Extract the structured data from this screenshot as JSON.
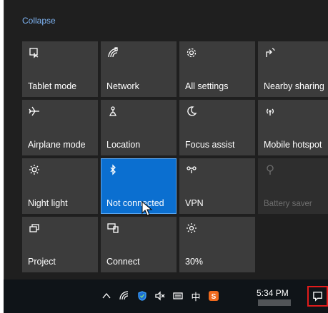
{
  "panel": {
    "collapse_label": "Collapse"
  },
  "tiles": [
    {
      "label": "Tablet mode",
      "icon": "tablet-mode-icon",
      "state": "off"
    },
    {
      "label": "Network",
      "icon": "network-icon",
      "state": "off"
    },
    {
      "label": "All settings",
      "icon": "gear-icon",
      "state": "off"
    },
    {
      "label": "Nearby sharing",
      "icon": "nearby-sharing-icon",
      "state": "off"
    },
    {
      "label": "Airplane mode",
      "icon": "airplane-icon",
      "state": "off"
    },
    {
      "label": "Location",
      "icon": "location-icon",
      "state": "off"
    },
    {
      "label": "Focus assist",
      "icon": "moon-icon",
      "state": "off"
    },
    {
      "label": "Mobile hotspot",
      "icon": "hotspot-icon",
      "state": "off"
    },
    {
      "label": "Night light",
      "icon": "night-light-icon",
      "state": "off"
    },
    {
      "label": "Not connected",
      "icon": "bluetooth-icon",
      "state": "on"
    },
    {
      "label": "VPN",
      "icon": "vpn-icon",
      "state": "off"
    },
    {
      "label": "Battery saver",
      "icon": "battery-saver-icon",
      "state": "disabled"
    },
    {
      "label": "Project",
      "icon": "project-icon",
      "state": "off"
    },
    {
      "label": "Connect",
      "icon": "connect-icon",
      "state": "off"
    },
    {
      "label": "30%",
      "icon": "brightness-icon",
      "state": "off"
    }
  ],
  "taskbar": {
    "tray_icons": [
      "chevron-up-icon",
      "wifi-icon",
      "security-shield-icon",
      "volume-muted-icon",
      "input-method-icon",
      "chinese-ime-icon",
      "sogou-icon"
    ],
    "ime_label": "中",
    "time": "5:34 PM"
  },
  "colors": {
    "accent": "#0b6fd0",
    "tile": "#3c3c3c",
    "panel": "#1f1f1f",
    "highlight": "#e21b1b"
  }
}
